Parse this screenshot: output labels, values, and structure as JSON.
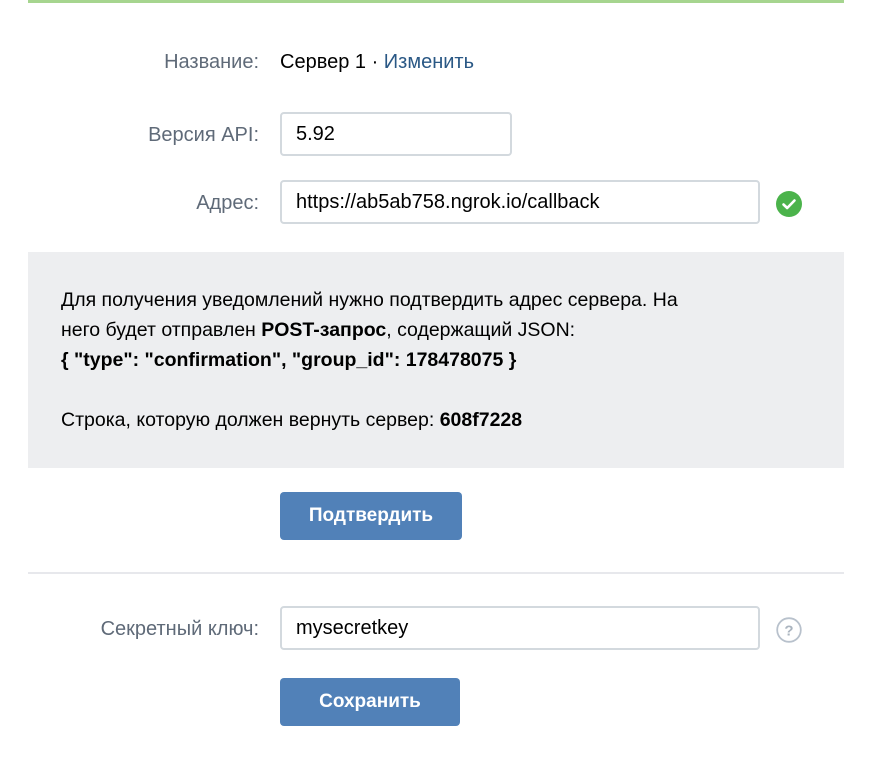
{
  "server": {
    "name_label": "Название:",
    "name_value": "Сервер 1",
    "name_separator": " · ",
    "change_link": "Изменить"
  },
  "api": {
    "label": "Версия API:",
    "value": "5.92"
  },
  "address": {
    "label": "Адрес:",
    "value": "https://ab5ab758.ngrok.io/callback",
    "status_icon": "check-circle-icon",
    "status_color": "#4bb34b"
  },
  "info": {
    "line1": "Для получения уведомлений нужно подтвердить адрес сервера. На",
    "line2_prefix": "него будет отправлен ",
    "line2_bold": "POST-запрос",
    "line2_suffix": ", содержащий JSON:",
    "json_line": "{ \"type\": \"confirmation\", \"group_id\": 178478075 }",
    "return_prefix": "Строка, которую должен вернуть сервер: ",
    "return_code": "608f7228"
  },
  "confirm_button": "Подтвердить",
  "secret": {
    "label": "Секретный ключ:",
    "value": "mysecretkey",
    "help_icon": "question-circle-icon"
  },
  "save_button": "Сохранить",
  "colors": {
    "accent": "#5181b8",
    "link": "#2a5885",
    "success": "#4bb34b",
    "panel": "#edeef0"
  }
}
